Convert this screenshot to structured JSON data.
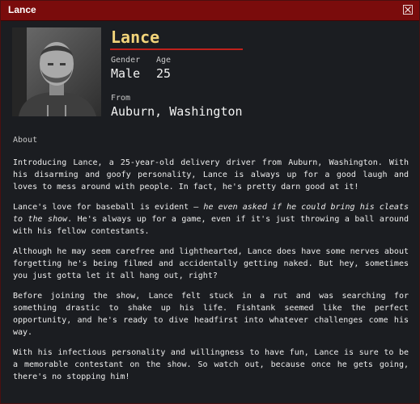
{
  "window": {
    "title": "Lance",
    "close_icon": "close-icon"
  },
  "profile": {
    "name": "Lance",
    "gender_label": "Gender",
    "gender": "Male",
    "age_label": "Age",
    "age": "25",
    "from_label": "From",
    "from": "Auburn, Washington",
    "photo_icon": "profile-photo"
  },
  "about": {
    "label": "About",
    "p1": "Introducing Lance, a 25-year-old delivery driver from Auburn, Washington. With his disarming and goofy personality, Lance is always up for a good laugh and loves to mess around with people. In fact, he's pretty darn good at it!",
    "p2_a": "Lance's love for baseball is evident — ",
    "p2_em": "he even asked if he could bring his cleats to the show",
    "p2_b": ". He's always up for a game, even if it's just throwing a ball around with his fellow contestants.",
    "p3": "Although he may seem carefree and lighthearted, Lance does have some nerves about forgetting he's being filmed and accidentally getting naked. But hey, sometimes you just gotta let it all hang out, right?",
    "p4": "Before joining the show, Lance felt stuck in a rut and was searching for something drastic to shake up his life. Fishtank seemed like the perfect opportunity, and he's ready to dive headfirst into whatever challenges come his way.",
    "p5": "With his infectious personality and willingness to have fun, Lance is sure to be a memorable contestant on the show. So watch out, because once he gets going, there's no stopping him!"
  },
  "colors": {
    "titlebar": "#7a0c0c",
    "background": "#1b1d21",
    "name": "#f2d47a",
    "accent_rule": "#c0211b"
  }
}
